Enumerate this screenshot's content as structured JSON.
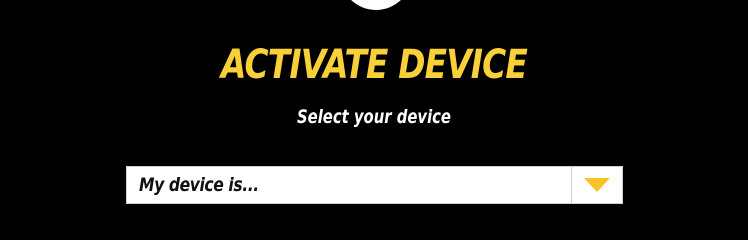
{
  "header": {
    "title": "ACTIVATE DEVICE",
    "subtitle": "Select your device"
  },
  "device_select": {
    "selected_value": "My device is...",
    "arrow_icon": "chevron-down-icon"
  },
  "colors": {
    "background": "#000000",
    "accent": "#f9d038",
    "text_light": "#ffffff"
  }
}
